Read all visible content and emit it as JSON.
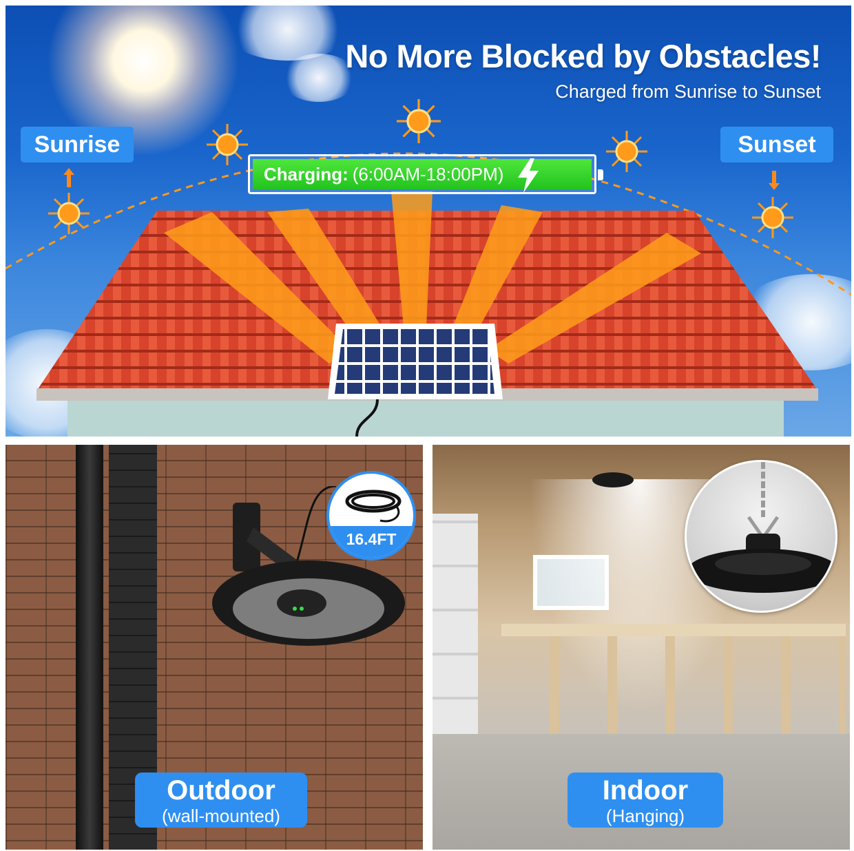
{
  "headline": "No More Blocked by Obstacles!",
  "subheadline": "Charged from Sunrise to Sunset",
  "sunrise_label": "Sunrise",
  "sunset_label": "Sunset",
  "charging": {
    "label": "Charging:",
    "hours": "(6:00AM-18:00PM)"
  },
  "cable_length": "16.4FT",
  "outdoor": {
    "title": "Outdoor",
    "subtitle": "(wall-mounted)"
  },
  "indoor": {
    "title": "Indoor",
    "subtitle": "(Hanging)"
  },
  "colors": {
    "accent_blue": "#2f8ff0",
    "charge_green": "#2fd12a",
    "sun_orange": "#ff9a1a",
    "roof_red": "#d8432c"
  }
}
